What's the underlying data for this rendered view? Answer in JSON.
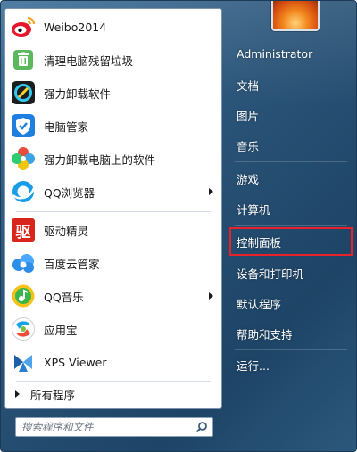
{
  "left_pane": {
    "programs": [
      {
        "label": "Weibo2014",
        "icon": "weibo-icon",
        "has_submenu": false
      },
      {
        "label": "清理电脑残留垃圾",
        "icon": "recycle-bin-icon",
        "has_submenu": false
      },
      {
        "label": "强力卸载软件",
        "icon": "uninstaller-icon",
        "has_submenu": false
      },
      {
        "label": "电脑管家",
        "icon": "shield-icon",
        "has_submenu": false
      },
      {
        "label": "强力卸载电脑上的软件",
        "icon": "flower-icon",
        "has_submenu": false
      },
      {
        "label": "QQ浏览器",
        "icon": "qq-browser-icon",
        "has_submenu": true
      },
      {
        "label": "驱动精灵",
        "icon": "driver-icon",
        "has_submenu": false
      },
      {
        "label": "百度云管家",
        "icon": "baidu-cloud-icon",
        "has_submenu": false
      },
      {
        "label": "QQ音乐",
        "icon": "qq-music-icon",
        "has_submenu": true
      },
      {
        "label": "应用宝",
        "icon": "app-store-icon",
        "has_submenu": false
      },
      {
        "label": "XPS Viewer",
        "icon": "xps-viewer-icon",
        "has_submenu": false
      }
    ],
    "all_programs_label": "所有程序"
  },
  "driver_icon_glyph": "驱",
  "search": {
    "placeholder": "搜索程序和文件"
  },
  "right_pane": {
    "items": [
      {
        "label": "Administrator",
        "highlight": false
      },
      {
        "label": "文档",
        "highlight": false
      },
      {
        "label": "图片",
        "highlight": false
      },
      {
        "label": "音乐",
        "highlight": false
      },
      {
        "label": "游戏",
        "highlight": false
      },
      {
        "label": "计算机",
        "highlight": false
      },
      {
        "label": "控制面板",
        "highlight": true
      },
      {
        "label": "设备和打印机",
        "highlight": false
      },
      {
        "label": "默认程序",
        "highlight": false
      },
      {
        "label": "帮助和支持",
        "highlight": false
      },
      {
        "label": "运行...",
        "highlight": false
      }
    ]
  },
  "colors": {
    "menu_background": "#2a5478",
    "highlight_border": "#e8212a",
    "left_pane_background": "#ffffff"
  }
}
